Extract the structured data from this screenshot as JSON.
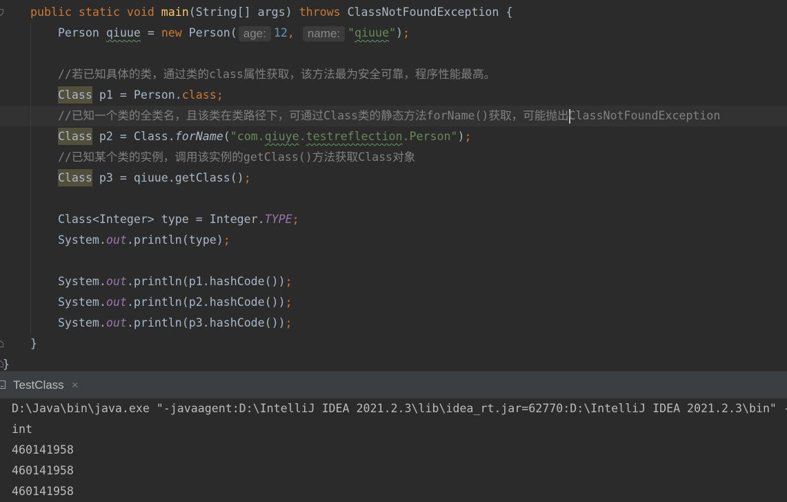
{
  "theme": {
    "editor_background": "#2b2b2b",
    "current_line_background": "#323232",
    "keyword": "#cc7832",
    "method_declaration": "#ffc66d",
    "identifier": "#a9b7c6",
    "number": "#6897bb",
    "string": "#6a8759",
    "comment": "#808080",
    "static_field": "#9876aa",
    "warning_background": "#52503a",
    "typo_underline": "#659c6b",
    "hint_background": "#3b3b3b",
    "hint_text": "#878787",
    "caret": "#bbbbbb",
    "tool_window_background": "#3c3f41",
    "tab_text": "#bbbbbb",
    "console_text": "#bbbbbb"
  },
  "gutter": {
    "icons": [
      "fold-start-icon",
      "fold-end-icon",
      "fold-end-icon"
    ]
  },
  "editor": {
    "lines": [
      {
        "indent": 4,
        "tokens": [
          {
            "keyword": "public static void "
          },
          {
            "method": "main"
          },
          {
            "plain": "(String[] args) "
          },
          {
            "keyword": "throws"
          },
          {
            "plain": " ClassNotFoundException {"
          }
        ]
      },
      {
        "indent": 8,
        "tokens": [
          {
            "plain": "Person "
          },
          {
            "typo": "qiuue"
          },
          {
            "plain": " = "
          },
          {
            "keyword": "new"
          },
          {
            "plain": " Person("
          },
          {
            "hint": "age:"
          },
          {
            "number": "12"
          },
          {
            "keyword": ", "
          },
          {
            "hint": "name:"
          },
          {
            "string": "\""
          },
          {
            "string_typo": "qiuue"
          },
          {
            "string": "\""
          },
          {
            "plain": ")"
          },
          {
            "keyword": ";"
          }
        ]
      },
      {
        "indent": 8,
        "tokens": []
      },
      {
        "indent": 8,
        "tokens": [
          {
            "comment": "//若已知具体的类，通过类的class属性获取，该方法最为安全可靠，程序性能最高。"
          }
        ]
      },
      {
        "indent": 8,
        "tokens": [
          {
            "warning": "Class"
          },
          {
            "plain": " p1 = Person."
          },
          {
            "keyword": "class;"
          }
        ]
      },
      {
        "indent": 8,
        "current": true,
        "tokens": [
          {
            "comment": "//已知一个类的全类名，且该类在类路径下，可通过Class类的静态方法forName()获取，可能抛出"
          },
          {
            "caret": true
          },
          {
            "comment": "ClassNotFoundException"
          }
        ]
      },
      {
        "indent": 8,
        "tokens": [
          {
            "warning": "Class"
          },
          {
            "plain": " p2 = Class."
          },
          {
            "static_call": "forName"
          },
          {
            "plain": "("
          },
          {
            "string": "\"com."
          },
          {
            "string_typo": "qiuye"
          },
          {
            "string": "."
          },
          {
            "string_typo": "testreflection"
          },
          {
            "string": ".Person\""
          },
          {
            "plain": ")"
          },
          {
            "keyword": ";"
          }
        ]
      },
      {
        "indent": 8,
        "tokens": [
          {
            "comment": "//已知某个类的实例，调用该实例的getClass()方法获取Class对象"
          }
        ]
      },
      {
        "indent": 8,
        "tokens": [
          {
            "warning": "Class"
          },
          {
            "plain": " p3 = qiuue.getClass()"
          },
          {
            "keyword": ";"
          }
        ]
      },
      {
        "indent": 8,
        "tokens": []
      },
      {
        "indent": 8,
        "tokens": [
          {
            "plain": "Class<Integer> type = Integer."
          },
          {
            "static_field": "TYPE"
          },
          {
            "keyword": ";"
          }
        ]
      },
      {
        "indent": 8,
        "tokens": [
          {
            "plain": "System."
          },
          {
            "static_field": "out"
          },
          {
            "plain": ".println(type)"
          },
          {
            "keyword": ";"
          }
        ]
      },
      {
        "indent": 8,
        "tokens": []
      },
      {
        "indent": 8,
        "tokens": [
          {
            "plain": "System."
          },
          {
            "static_field": "out"
          },
          {
            "plain": ".println(p1.hashCode())"
          },
          {
            "keyword": ";"
          }
        ]
      },
      {
        "indent": 8,
        "tokens": [
          {
            "plain": "System."
          },
          {
            "static_field": "out"
          },
          {
            "plain": ".println(p2.hashCode())"
          },
          {
            "keyword": ";"
          }
        ]
      },
      {
        "indent": 8,
        "tokens": [
          {
            "plain": "System."
          },
          {
            "static_field": "out"
          },
          {
            "plain": ".println(p3.hashCode())"
          },
          {
            "keyword": ";"
          }
        ]
      },
      {
        "indent": 4,
        "tokens": [
          {
            "plain": "}"
          }
        ]
      },
      {
        "indent": 0,
        "tokens": [
          {
            "plain": "}"
          }
        ]
      }
    ]
  },
  "run_panel": {
    "tab": {
      "icon": "console-icon",
      "label": "TestClass",
      "close": "×"
    },
    "console": {
      "lines": [
        "D:\\Java\\bin\\java.exe \"-javaagent:D:\\IntelliJ IDEA 2021.2.3\\lib\\idea_rt.jar=62770:D:\\IntelliJ IDEA 2021.2.3\\bin\" -",
        "int",
        "460141958",
        "460141958",
        "460141958"
      ]
    }
  }
}
